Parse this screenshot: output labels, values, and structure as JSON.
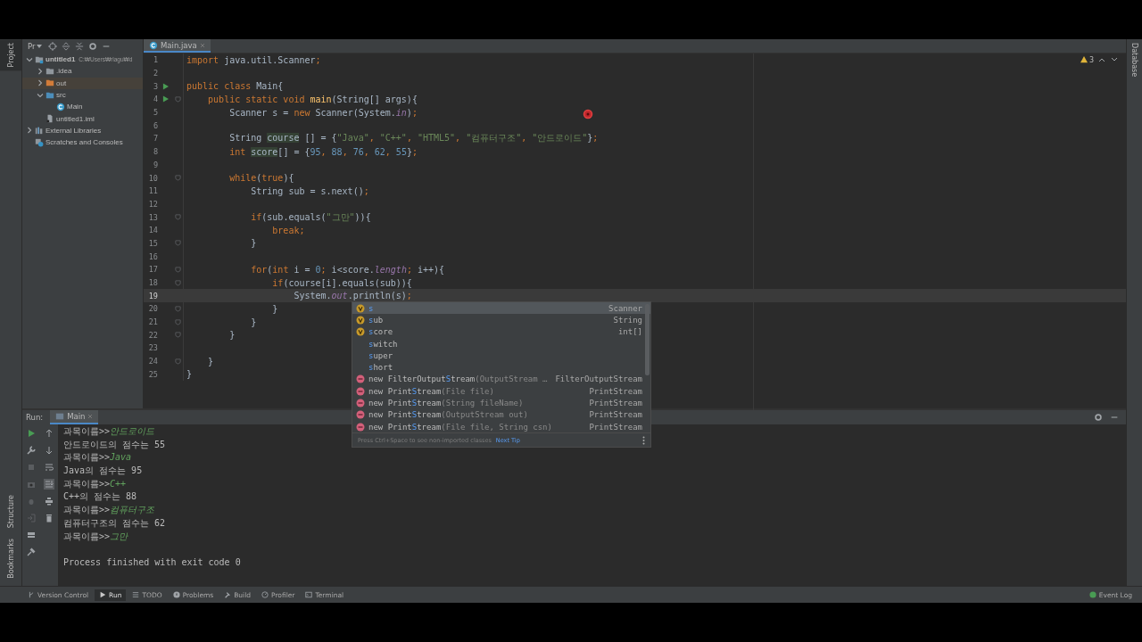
{
  "left_tool_windows": [
    {
      "label": "Project",
      "selected": true
    },
    {
      "label": "Structure",
      "selected": false
    },
    {
      "label": "Bookmarks",
      "selected": false
    }
  ],
  "right_tool_windows": [
    {
      "label": "Database",
      "selected": false
    }
  ],
  "project_panel": {
    "title": "Pr",
    "tree": [
      {
        "label": "untitled1",
        "path": "C:₩Users₩rlagu₩d",
        "kind": "module",
        "expanded": true,
        "children": [
          {
            "label": ".idea",
            "kind": "folder",
            "expanded": false
          },
          {
            "label": "out",
            "kind": "excluded",
            "expanded": false
          },
          {
            "label": "src",
            "kind": "source",
            "expanded": true,
            "children": [
              {
                "label": "Main",
                "kind": "class"
              }
            ]
          },
          {
            "label": "untitled1.iml",
            "kind": "file"
          }
        ]
      },
      {
        "label": "External Libraries",
        "kind": "library",
        "expanded": false
      },
      {
        "label": "Scratches and Consoles",
        "kind": "scratches"
      }
    ]
  },
  "editor": {
    "tabs": [
      {
        "label": "Main.java",
        "selected": true
      }
    ],
    "warnings": "3",
    "lines": [
      {
        "number": "1",
        "run_marker": false,
        "fold_marker": false,
        "current": false,
        "tokens": [
          {
            "kind": "kw",
            "text": "import"
          },
          {
            "kind": "plain",
            "text": " java.util.Scanner"
          },
          {
            "kind": "kw",
            "text": ";"
          }
        ]
      },
      {
        "number": "2",
        "run_marker": false,
        "fold_marker": false,
        "current": false
      },
      {
        "number": "3",
        "run_marker": true,
        "fold_marker": false,
        "current": false,
        "tokens": [
          {
            "kind": "kw",
            "text": "public class"
          },
          {
            "kind": "plain",
            "text": " Main{"
          }
        ]
      },
      {
        "number": "4",
        "run_marker": true,
        "fold_marker": true,
        "current": false,
        "tokens": [
          {
            "kind": "kw",
            "text": "    public static void "
          },
          {
            "kind": "fn",
            "text": "main"
          },
          {
            "kind": "plain",
            "text": "(String[] args){"
          }
        ]
      },
      {
        "number": "5",
        "run_marker": false,
        "fold_marker": false,
        "current": false,
        "tokens": [
          {
            "kind": "plain",
            "text": "        Scanner s = "
          },
          {
            "kind": "kw",
            "text": "new"
          },
          {
            "kind": "plain",
            "text": " Scanner(System."
          },
          {
            "kind": "field",
            "text": "in"
          },
          {
            "kind": "plain",
            "text": ")"
          },
          {
            "kind": "kw",
            "text": ";"
          }
        ]
      },
      {
        "number": "6",
        "run_marker": false,
        "fold_marker": false,
        "current": false
      },
      {
        "number": "7",
        "run_marker": false,
        "fold_marker": false,
        "current": false,
        "tokens": [
          {
            "kind": "plain",
            "text": "        String "
          },
          {
            "kind": "hl",
            "text": "course"
          },
          {
            "kind": "plain",
            "text": " [] = {"
          },
          {
            "kind": "str",
            "text": "\"Java\""
          },
          {
            "kind": "kw",
            "text": ", "
          },
          {
            "kind": "str",
            "text": "\"C++\""
          },
          {
            "kind": "kw",
            "text": ", "
          },
          {
            "kind": "str",
            "text": "\"HTML5\""
          },
          {
            "kind": "kw",
            "text": ", "
          },
          {
            "kind": "str",
            "text": "\"컴퓨터구조\""
          },
          {
            "kind": "kw",
            "text": ", "
          },
          {
            "kind": "str",
            "text": "\"안드로이드\""
          },
          {
            "kind": "plain",
            "text": "}"
          },
          {
            "kind": "kw",
            "text": ";"
          }
        ]
      },
      {
        "number": "8",
        "run_marker": false,
        "fold_marker": false,
        "current": false,
        "tokens": [
          {
            "kind": "kw",
            "text": "        int "
          },
          {
            "kind": "hl",
            "text": "score"
          },
          {
            "kind": "plain",
            "text": "[] = {"
          },
          {
            "kind": "num",
            "text": "95"
          },
          {
            "kind": "kw",
            "text": ", "
          },
          {
            "kind": "num",
            "text": "88"
          },
          {
            "kind": "kw",
            "text": ", "
          },
          {
            "kind": "num",
            "text": "76"
          },
          {
            "kind": "kw",
            "text": ", "
          },
          {
            "kind": "num",
            "text": "62"
          },
          {
            "kind": "kw",
            "text": ", "
          },
          {
            "kind": "num",
            "text": "55"
          },
          {
            "kind": "plain",
            "text": "}"
          },
          {
            "kind": "kw",
            "text": ";"
          }
        ]
      },
      {
        "number": "9",
        "run_marker": false,
        "fold_marker": false,
        "current": false
      },
      {
        "number": "10",
        "run_marker": false,
        "fold_marker": true,
        "current": false,
        "tokens": [
          {
            "kind": "kw",
            "text": "        while"
          },
          {
            "kind": "plain",
            "text": "("
          },
          {
            "kind": "kw",
            "text": "true"
          },
          {
            "kind": "plain",
            "text": "){"
          }
        ]
      },
      {
        "number": "11",
        "run_marker": false,
        "fold_marker": false,
        "current": false,
        "tokens": [
          {
            "kind": "plain",
            "text": "            String sub = s.next()"
          },
          {
            "kind": "kw",
            "text": ";"
          }
        ]
      },
      {
        "number": "12",
        "run_marker": false,
        "fold_marker": false,
        "current": false
      },
      {
        "number": "13",
        "run_marker": false,
        "fold_marker": true,
        "current": false,
        "tokens": [
          {
            "kind": "kw",
            "text": "            if"
          },
          {
            "kind": "plain",
            "text": "(sub.equals("
          },
          {
            "kind": "str",
            "text": "\"그만\""
          },
          {
            "kind": "plain",
            "text": ")){"
          }
        ]
      },
      {
        "number": "14",
        "run_marker": false,
        "fold_marker": false,
        "current": false,
        "tokens": [
          {
            "kind": "kw",
            "text": "                break;"
          }
        ]
      },
      {
        "number": "15",
        "run_marker": false,
        "fold_marker": true,
        "current": false,
        "tokens": [
          {
            "kind": "plain",
            "text": "            }"
          }
        ]
      },
      {
        "number": "16",
        "run_marker": false,
        "fold_marker": false,
        "current": false
      },
      {
        "number": "17",
        "run_marker": false,
        "fold_marker": true,
        "current": false,
        "tokens": [
          {
            "kind": "kw",
            "text": "            for"
          },
          {
            "kind": "plain",
            "text": "("
          },
          {
            "kind": "kw",
            "text": "int "
          },
          {
            "kind": "plain",
            "text": "i = "
          },
          {
            "kind": "num",
            "text": "0"
          },
          {
            "kind": "kw",
            "text": "; "
          },
          {
            "kind": "plain",
            "text": "i<score."
          },
          {
            "kind": "field",
            "text": "length"
          },
          {
            "kind": "kw",
            "text": "; "
          },
          {
            "kind": "plain",
            "text": "i++){"
          }
        ]
      },
      {
        "number": "18",
        "run_marker": false,
        "fold_marker": true,
        "current": false,
        "tokens": [
          {
            "kind": "kw",
            "text": "                if"
          },
          {
            "kind": "plain",
            "text": "(course[i].equals(sub)){"
          }
        ]
      },
      {
        "number": "19",
        "run_marker": false,
        "fold_marker": false,
        "current": true,
        "tokens": [
          {
            "kind": "plain",
            "text": "                    System."
          },
          {
            "kind": "field",
            "text": "out"
          },
          {
            "kind": "plain",
            "text": ".println(s)"
          },
          {
            "kind": "kw",
            "text": ";"
          }
        ]
      },
      {
        "number": "20",
        "run_marker": false,
        "fold_marker": true,
        "current": false,
        "tokens": [
          {
            "kind": "plain",
            "text": "                }"
          }
        ]
      },
      {
        "number": "21",
        "run_marker": false,
        "fold_marker": true,
        "current": false,
        "tokens": [
          {
            "kind": "plain",
            "text": "            }"
          }
        ]
      },
      {
        "number": "22",
        "run_marker": false,
        "fold_marker": true,
        "current": false,
        "tokens": [
          {
            "kind": "plain",
            "text": "        }"
          }
        ]
      },
      {
        "number": "23",
        "run_marker": false,
        "fold_marker": false,
        "current": false
      },
      {
        "number": "24",
        "run_marker": false,
        "fold_marker": true,
        "current": false,
        "tokens": [
          {
            "kind": "plain",
            "text": "    }"
          }
        ]
      },
      {
        "number": "25",
        "run_marker": false,
        "fold_marker": false,
        "current": false,
        "tokens": [
          {
            "kind": "plain",
            "text": "}"
          }
        ]
      }
    ],
    "completion": {
      "items": [
        {
          "kind": "variable",
          "match": "s",
          "type": "Scanner",
          "selected": true
        },
        {
          "kind": "variable",
          "match": "s",
          "after": "ub",
          "type": "String",
          "selected": false
        },
        {
          "kind": "variable",
          "match": "s",
          "after": "core",
          "type": "int[]",
          "selected": false
        },
        {
          "kind": "keyword",
          "match": "s",
          "after": "witch",
          "selected": false
        },
        {
          "kind": "keyword",
          "match": "s",
          "after": "uper",
          "selected": false
        },
        {
          "kind": "keyword",
          "match": "s",
          "after": "hort",
          "selected": false
        },
        {
          "kind": "constructor",
          "before": "new FilterOutput",
          "match": "S",
          "after": "tream",
          "params": "(OutputStream …",
          "type": "FilterOutputStream",
          "selected": false
        },
        {
          "kind": "constructor",
          "before": "new Print",
          "match": "S",
          "after": "tream",
          "params": "(File file)",
          "type": "PrintStream",
          "selected": false
        },
        {
          "kind": "constructor",
          "before": "new Print",
          "match": "S",
          "after": "tream",
          "params": "(String fileName)",
          "type": "PrintStream",
          "selected": false
        },
        {
          "kind": "constructor",
          "before": "new Print",
          "match": "S",
          "after": "tream",
          "params": "(OutputStream out)",
          "type": "PrintStream",
          "selected": false
        },
        {
          "kind": "constructor",
          "before": "new Print",
          "match": "S",
          "after": "tream",
          "params": "(File file, String csn)",
          "type": "PrintStream",
          "selected": false
        }
      ],
      "hint": "Press Ctrl+Space to see non-imported classes",
      "hint_link": "Next Tip"
    }
  },
  "run": {
    "title": "Run:",
    "tabs": [
      {
        "label": "Main",
        "selected": true
      }
    ],
    "autoscroll": true,
    "console": [
      {
        "kind": "prompt",
        "text": "과목이름>>",
        "input": "안드로이드"
      },
      {
        "kind": "output",
        "text": "안드로이드의 점수는 55"
      },
      {
        "kind": "prompt",
        "text": "과목이름>>",
        "input": "Java"
      },
      {
        "kind": "output",
        "text": "Java의 점수는 95"
      },
      {
        "kind": "prompt",
        "text": "과목이름>>",
        "input": "C++"
      },
      {
        "kind": "output",
        "text": "C++의 점수는 88"
      },
      {
        "kind": "prompt",
        "text": "과목이름>>",
        "input": "컴퓨터구조"
      },
      {
        "kind": "output",
        "text": "컴퓨터구조의 점수는 62"
      },
      {
        "kind": "prompt",
        "text": "과목이름>>",
        "input": "그만"
      },
      {
        "kind": "blank"
      },
      {
        "kind": "output",
        "text": "Process finished with exit code 0"
      }
    ]
  },
  "status_bar": {
    "tools": [
      {
        "label": "Version Control",
        "kind": "branch",
        "selected": false
      },
      {
        "label": "Run",
        "kind": "play",
        "selected": true
      },
      {
        "label": "TODO",
        "kind": "list",
        "selected": false
      },
      {
        "label": "Problems",
        "kind": "info",
        "selected": false
      },
      {
        "label": "Build",
        "kind": "hammer",
        "selected": false
      },
      {
        "label": "Profiler",
        "kind": "gauge",
        "selected": false
      },
      {
        "label": "Terminal",
        "kind": "terminal",
        "selected": false
      }
    ],
    "event_log": "Event Log"
  }
}
